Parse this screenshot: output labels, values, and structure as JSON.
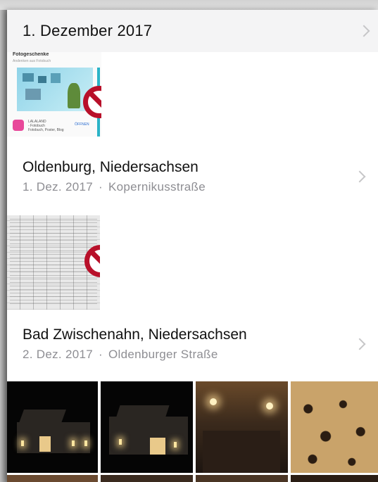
{
  "sections": [
    {
      "title": "1. Dezember 2017"
    },
    {
      "title": "Oldenburg, Niedersachsen",
      "date": "1. Dez. 2017",
      "separator": "·",
      "street": "Kopernikusstraße"
    },
    {
      "title": "Bad Zwischenahn, Niedersachsen",
      "date": "2. Dez. 2017",
      "separator": "·",
      "street": "Oldenburger Straße"
    }
  ],
  "screenshot_thumb": {
    "heading": "Fotogeschenke",
    "subheading": "Andenken aus Fotobuch",
    "app_text_1": "LALALAND",
    "app_text_2": "- Fotobuch",
    "app_text_3": "Fotobuch, Poster, Blog",
    "app_button": "ÖFFNEN"
  },
  "colors": {
    "blocked_icon": "#b8102a",
    "header_background": "#f4f4f5",
    "subtitle_gray": "#8e8e93"
  }
}
